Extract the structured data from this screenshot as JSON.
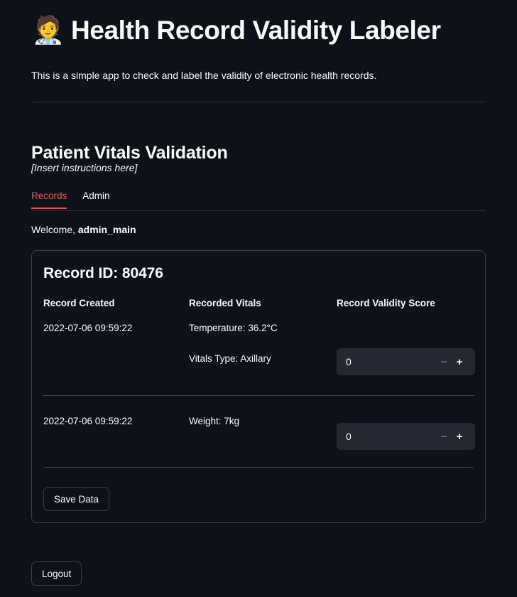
{
  "app": {
    "icon": "health-worker-emoji",
    "icon_glyph": "🧑‍⚕️",
    "title": "Health Record Validity Labeler",
    "description": "This is a simple app to check and label the validity of electronic health records."
  },
  "section": {
    "title": "Patient Vitals Validation",
    "instructions": "[Insert instructions here]"
  },
  "tabs": [
    {
      "label": "Records",
      "active": true
    },
    {
      "label": "Admin",
      "active": false
    }
  ],
  "welcome": {
    "prefix": "Welcome,",
    "username": "admin_main"
  },
  "card": {
    "record_id_label": "Record ID: 80476",
    "columns": [
      "Record Created",
      "Recorded Vitals",
      "Record Validity Score"
    ],
    "rows": [
      {
        "created": "2022-07-06 09:59:22",
        "vitals": [
          "Temperature: 36.2°C",
          "Vitals Type: Axillary"
        ],
        "score": "0",
        "decrement_label": "−",
        "increment_label": "+"
      },
      {
        "created": "2022-07-06 09:59:22",
        "vitals": [
          "Weight: 7kg"
        ],
        "score": "0",
        "decrement_label": "−",
        "increment_label": "+"
      }
    ],
    "save_label": "Save Data"
  },
  "logout_label": "Logout",
  "colors": {
    "background": "#0e1117",
    "text": "#fafafa",
    "accent": "#ff4b4b",
    "border": "#3b3d4a",
    "input_bg": "#262730",
    "muted": "#6b6d7a"
  }
}
